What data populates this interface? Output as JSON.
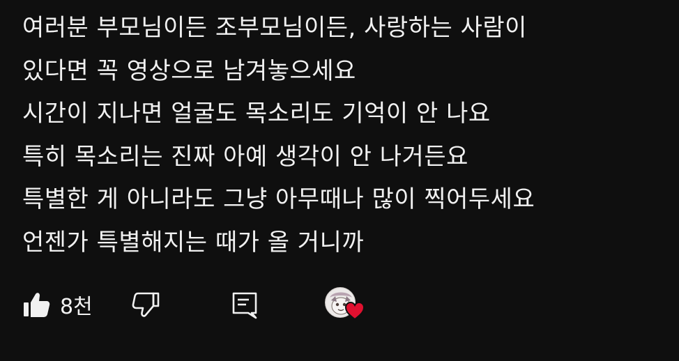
{
  "comment": {
    "lines": [
      "여러분 부모님이든 조부모님이든, 사랑하는 사람이",
      "있다면 꼭 영상으로 남겨놓으세요",
      "시간이 지나면 얼굴도 목소리도 기억이 안 나요",
      "특히 목소리는 진짜 아예 생각이 안 나거든요",
      "특별한 게 아니라도 그냥 아무때나 많이 찍어두세요",
      "언젠가 특별해지는 때가 올 거니까"
    ]
  },
  "actions": {
    "like_count": "8천",
    "like_icon": "thumbs-up-icon",
    "dislike_icon": "thumbs-down-icon",
    "reply_icon": "reply-comment-icon",
    "creator_heart_icon": "heart-icon",
    "heart_color": "#e0102f"
  },
  "colors": {
    "background": "#0f0f0f",
    "text": "#f1f1f1"
  }
}
